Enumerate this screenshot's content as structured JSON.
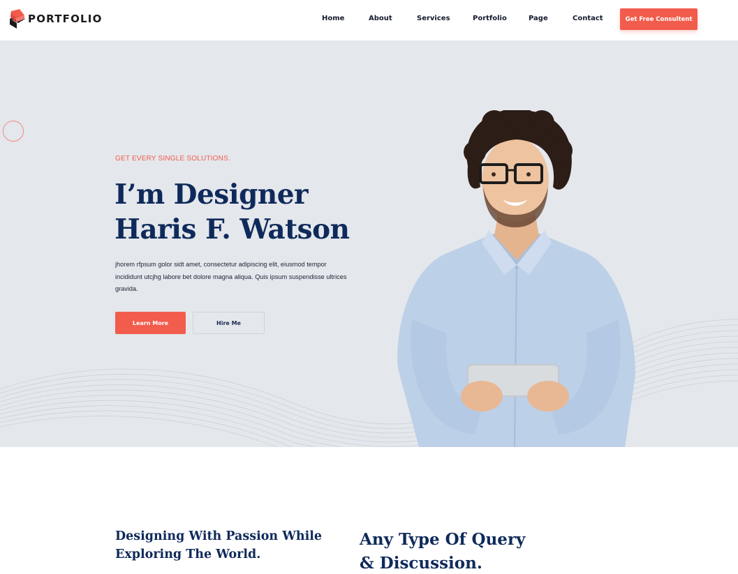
{
  "brand": {
    "name": "PORTFOLIO",
    "accent": "#f25c4d",
    "dark": "#0f2a5a"
  },
  "nav": {
    "items": [
      {
        "label": "Home"
      },
      {
        "label": "About"
      },
      {
        "label": "Services"
      },
      {
        "label": "Portfolio"
      },
      {
        "label": "Page"
      },
      {
        "label": "Contact"
      }
    ],
    "cta_label": "Get Free Consultent"
  },
  "hero": {
    "tagline": "GET EVERY SINGLE SOLUTIONS.",
    "title_line1": "I’m Designer",
    "title_line2": "Haris F. Watson",
    "description": "jhorem rfpsum golor sidt amet, consectetur adipiscing elit, eiusmod tempor incididunt utcjhg labore bet dolore magna aliqua. Quis ipsum suspendisse ultrices gravida.",
    "primary_button": "Learn More",
    "secondary_button": "Hire Me",
    "background_color": "#e4e7ec"
  },
  "sections": {
    "left_heading_line1": "Designing With Passion While",
    "left_heading_line2": "Exploring The World.",
    "right_heading_line1": "Any Type Of Query",
    "right_heading_line2": "& Discussion."
  }
}
